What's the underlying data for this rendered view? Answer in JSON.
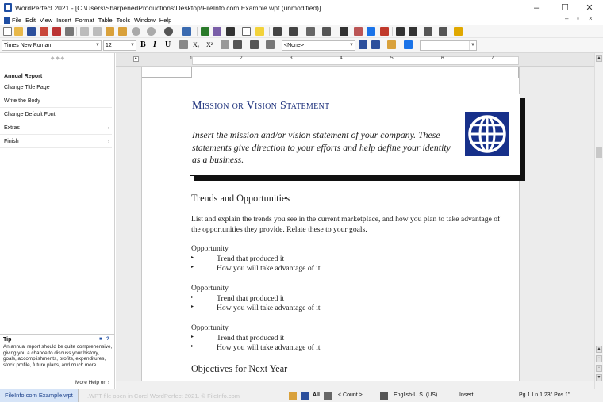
{
  "window": {
    "title": "WordPerfect 2021 - [C:\\Users\\SharpenedProductions\\Desktop\\FileInfo.com Example.wpt (unmodified)]",
    "controls": {
      "minimize": "–",
      "maximize": "☐",
      "close": "✕"
    }
  },
  "menu": {
    "items": [
      "File",
      "Edit",
      "View",
      "Insert",
      "Format",
      "Table",
      "Tools",
      "Window",
      "Help"
    ],
    "mdi_controls": {
      "minimize": "–",
      "restore": "▫",
      "close": "×"
    }
  },
  "format_bar": {
    "font_name": "Times New Roman",
    "font_size": "12",
    "bold": "B",
    "italic": "I",
    "underline": "U",
    "subscript": "X₂",
    "superscript": "X²",
    "style_value": "<None>",
    "style_box2_value": ""
  },
  "sidebar": {
    "heading": "Annual Report",
    "items": [
      {
        "label": "Change Title Page",
        "has_chevron": false
      },
      {
        "label": "Write the Body",
        "has_chevron": false
      },
      {
        "label": "Change Default Font",
        "has_chevron": false
      },
      {
        "label": "Extras",
        "has_chevron": true
      },
      {
        "label": "Finish",
        "has_chevron": true
      }
    ],
    "chevron": "›",
    "tip": {
      "heading": "Tip",
      "text": "An annual report should be quite comprehensive, giving you a chance to discuss your history, goals, accomplishments, profits, expenditures, stock profile, future plans, and much more.",
      "more_link": "More Help on ›"
    }
  },
  "ruler": {
    "numbers": [
      "1",
      "2",
      "3",
      "4",
      "5",
      "6",
      "7"
    ]
  },
  "document": {
    "mission_title": "Mission or Vision Statement",
    "mission_body": "Insert the mission and/or vision statement of your company. These statements give direction to your efforts and help define your identity as a business.",
    "trends_heading": "Trends and Opportunities",
    "trends_paragraph": "List and explain the trends you see in the current marketplace, and how you plan to take advantage of the opportunities they provide. Relate these to your goals.",
    "opportunities": [
      {
        "title": "Opportunity",
        "bullets": [
          "Trend that produced it",
          "How you will take advantage of it"
        ]
      },
      {
        "title": "Opportunity",
        "bullets": [
          "Trend that produced it",
          "How you will take advantage of it"
        ]
      },
      {
        "title": "Opportunity",
        "bullets": [
          "Trend that produced it",
          "How you will take advantage of it"
        ]
      }
    ],
    "bullet_glyph": "▸",
    "objectives_heading": "Objectives for Next Year"
  },
  "status": {
    "doc_tab": "FileInfo.com Example.wpt",
    "watermark": ".WPT file open in Corel WordPerfect 2021. © FileInfo.com",
    "all_label": "All",
    "count": "< Count >",
    "language": "English-U.S. (US)",
    "mode": "Insert",
    "position": "Pg 1 Ln 1.23\" Pos 1\""
  },
  "colors": {
    "heading_blue": "#1a2e7a",
    "globe_blue": "#17308a",
    "tab_blue": "#d6e4f7"
  }
}
